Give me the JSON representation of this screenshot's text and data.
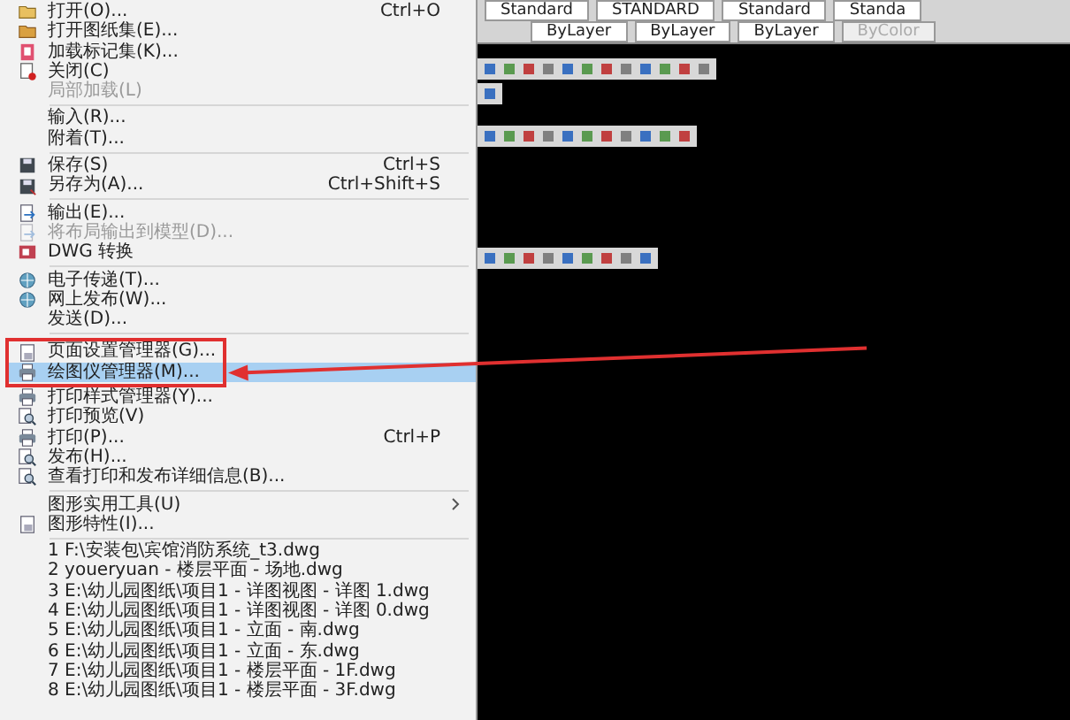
{
  "menu": {
    "items": [
      {
        "kind": "item",
        "label": "打开(O)...",
        "shortcut": "Ctrl+O",
        "disabled": false,
        "selected": false,
        "has_submenu": false
      },
      {
        "kind": "item",
        "label": "打开图纸集(E)...",
        "disabled": false,
        "selected": false,
        "has_submenu": false
      },
      {
        "kind": "item",
        "label": "加载标记集(K)...",
        "disabled": false,
        "selected": false,
        "has_submenu": false
      },
      {
        "kind": "item",
        "label": "关闭(C)",
        "disabled": false,
        "selected": false,
        "has_submenu": false
      },
      {
        "kind": "item",
        "label": "局部加载(L)",
        "disabled": true,
        "selected": false,
        "has_submenu": false
      },
      {
        "kind": "separator"
      },
      {
        "kind": "item",
        "label": "输入(R)...",
        "disabled": false,
        "selected": false,
        "has_submenu": false
      },
      {
        "kind": "item",
        "label": "附着(T)...",
        "disabled": false,
        "selected": false,
        "has_submenu": false
      },
      {
        "kind": "separator"
      },
      {
        "kind": "item",
        "label": "保存(S)",
        "shortcut": "Ctrl+S",
        "disabled": false,
        "selected": false,
        "has_submenu": false
      },
      {
        "kind": "item",
        "label": "另存为(A)...",
        "shortcut": "Ctrl+Shift+S",
        "disabled": false,
        "selected": false,
        "has_submenu": false
      },
      {
        "kind": "separator"
      },
      {
        "kind": "item",
        "label": "输出(E)...",
        "disabled": false,
        "selected": false,
        "has_submenu": false
      },
      {
        "kind": "item",
        "label": "将布局输出到模型(D)...",
        "disabled": true,
        "selected": false,
        "has_submenu": false
      },
      {
        "kind": "item",
        "label": "DWG 转换",
        "disabled": false,
        "selected": false,
        "has_submenu": false
      },
      {
        "kind": "separator"
      },
      {
        "kind": "item",
        "label": "电子传递(T)...",
        "disabled": false,
        "selected": false,
        "has_submenu": false
      },
      {
        "kind": "item",
        "label": "网上发布(W)...",
        "disabled": false,
        "selected": false,
        "has_submenu": false
      },
      {
        "kind": "item",
        "label": "发送(D)...",
        "disabled": false,
        "selected": false,
        "has_submenu": false
      },
      {
        "kind": "separator"
      },
      {
        "kind": "item",
        "label": "页面设置管理器(G)...",
        "disabled": false,
        "selected": false,
        "has_submenu": false
      },
      {
        "kind": "item",
        "label": "绘图仪管理器(M)...",
        "disabled": false,
        "selected": true,
        "has_submenu": false
      },
      {
        "kind": "item",
        "label": "打印样式管理器(Y)...",
        "disabled": false,
        "selected": false,
        "has_submenu": false
      },
      {
        "kind": "item",
        "label": "打印预览(V)",
        "disabled": false,
        "selected": false,
        "has_submenu": false
      },
      {
        "kind": "item",
        "label": "打印(P)...",
        "shortcut": "Ctrl+P",
        "disabled": false,
        "selected": false,
        "has_submenu": false
      },
      {
        "kind": "item",
        "label": "发布(H)...",
        "disabled": false,
        "selected": false,
        "has_submenu": false
      },
      {
        "kind": "item",
        "label": "查看打印和发布详细信息(B)...",
        "disabled": false,
        "selected": false,
        "has_submenu": false
      },
      {
        "kind": "separator"
      },
      {
        "kind": "item",
        "label": "图形实用工具(U)",
        "disabled": false,
        "selected": false,
        "has_submenu": true
      },
      {
        "kind": "item",
        "label": "图形特性(I)...",
        "disabled": false,
        "selected": false,
        "has_submenu": false
      },
      {
        "kind": "separator"
      },
      {
        "kind": "item",
        "label": "1 F:\\安装包\\宾馆消防系统_t3.dwg",
        "disabled": false,
        "selected": false,
        "has_submenu": false
      },
      {
        "kind": "item",
        "label": "2 youeryuan - 楼层平面 - 场地.dwg",
        "disabled": false,
        "selected": false,
        "has_submenu": false
      },
      {
        "kind": "item",
        "label": "3 E:\\幼儿园图纸\\项目1 - 详图视图 - 详图 1.dwg",
        "disabled": false,
        "selected": false,
        "has_submenu": false
      },
      {
        "kind": "item",
        "label": "4 E:\\幼儿园图纸\\项目1 - 详图视图 - 详图 0.dwg",
        "disabled": false,
        "selected": false,
        "has_submenu": false
      },
      {
        "kind": "item",
        "label": "5 E:\\幼儿园图纸\\项目1 - 立面 - 南.dwg",
        "disabled": false,
        "selected": false,
        "has_submenu": false
      },
      {
        "kind": "item",
        "label": "6 E:\\幼儿园图纸\\项目1 - 立面 - 东.dwg",
        "disabled": false,
        "selected": false,
        "has_submenu": false
      },
      {
        "kind": "item",
        "label": "7 E:\\幼儿园图纸\\项目1 - 楼层平面 - 1F.dwg",
        "disabled": false,
        "selected": false,
        "has_submenu": false
      },
      {
        "kind": "item",
        "label": "8 E:\\幼儿园图纸\\项目1 - 楼层平面 - 3F.dwg",
        "disabled": false,
        "selected": false,
        "has_submenu": false
      }
    ]
  },
  "toolbar": {
    "styles": [
      "Standard",
      "STANDARD",
      "Standard",
      "Standa"
    ],
    "properties": [
      {
        "value": "ByLayer",
        "disabled": false
      },
      {
        "value": "ByLayer",
        "disabled": false
      },
      {
        "value": "ByLayer",
        "disabled": false
      },
      {
        "value": "ByColor",
        "disabled": true
      }
    ]
  }
}
